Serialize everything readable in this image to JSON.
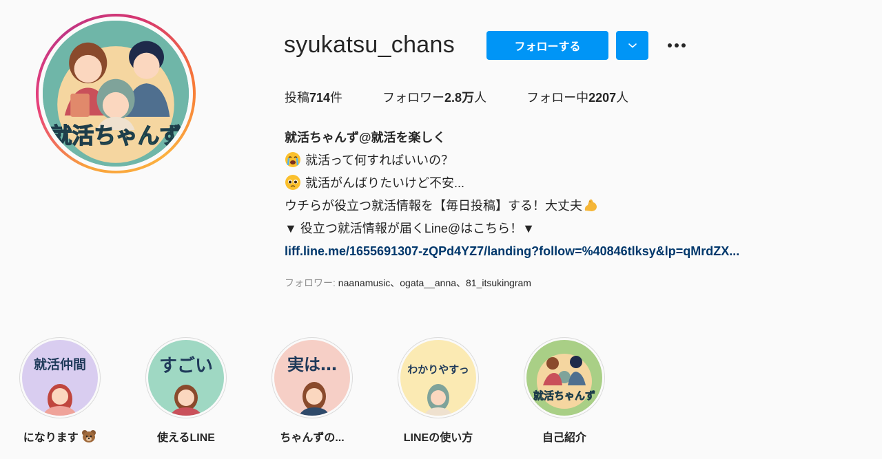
{
  "profile": {
    "username": "syukatsu_chans",
    "follow_label": "フォローする",
    "avatar_text": "就活ちゃんず"
  },
  "stats": {
    "posts_prefix": "投稿",
    "posts_count": "714",
    "posts_suffix": "件",
    "followers_prefix": "フォロワー",
    "followers_count": "2.8万",
    "followers_suffix": "人",
    "following_prefix": "フォロー中",
    "following_count": "2207",
    "following_suffix": "人"
  },
  "bio": {
    "name": "就活ちゃんず@就活を楽しく",
    "line1": "就活って何すればいいの？",
    "line1_icon": "crying-face-emoji",
    "line2": "就活がんばりたいけど不安...",
    "line2_icon": "pleading-face-emoji",
    "line3": "ウチらが役立つ就活情報を【毎日投稿】する！大丈夫",
    "line3_icon": "flexed-biceps-emoji",
    "line4": "▼ 役立つ就活情報が届くLine@はこちら！▼",
    "link": "liff.line.me/1655691307-zQPd4YZ7/landing?follow=%40846tlksy&lp=qMrdZX..."
  },
  "followed_by": {
    "label": "フォロワー: ",
    "names": "naanamusic、ogata__anna、81_itsukingram"
  },
  "highlights": [
    {
      "label": "になります",
      "cover_text": "就活仲間",
      "bg": "#d9cdf0",
      "label_icon": "bear-emoji"
    },
    {
      "label": "使えるLINE",
      "cover_text": "すごい",
      "bg": "#9fd8c3"
    },
    {
      "label": "ちゃんずの...",
      "cover_text": "実は…",
      "bg": "#f6cfc6"
    },
    {
      "label": "LINEの使い方",
      "cover_text": "わかりやすっ",
      "bg": "#fbeab3"
    },
    {
      "label": "自己紹介",
      "cover_text": "就活ちゃんず",
      "bg": "#a9cf86"
    }
  ],
  "colors": {
    "accent": "#0095f6",
    "link": "#00376b",
    "muted": "#8e8e8e"
  }
}
